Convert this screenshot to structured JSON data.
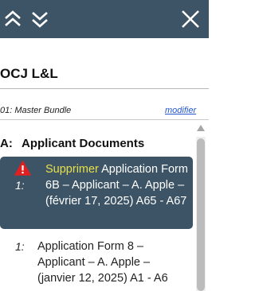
{
  "header": {
    "colors": {
      "bar": "#3c5466",
      "icon": "#ffffff"
    },
    "icons": [
      "double-chevron-up-icon",
      "double-chevron-down-icon",
      "close-icon"
    ]
  },
  "title": "OCJ L&L",
  "bundle": {
    "label": "01: Master Bundle",
    "modify_link": "modifier"
  },
  "section": {
    "letter": "A:",
    "label": "Applicant Documents"
  },
  "items": [
    {
      "number": "1:",
      "action": "Supprimer",
      "text": "Application Form 6B – Applicant – A. Apple – (février 17, 2025) A65 - A67",
      "selected": true,
      "icon": "warning-icon"
    },
    {
      "number": "1:",
      "text": "Application Form 8 – Applicant – A. Apple – (janvier 12, 2025) A1 - A6",
      "selected": false
    }
  ],
  "colors": {
    "selected_bg": "#3c5466",
    "action_highlight": "#e8e04a",
    "warning": "#e02020",
    "link": "#2255cc"
  }
}
